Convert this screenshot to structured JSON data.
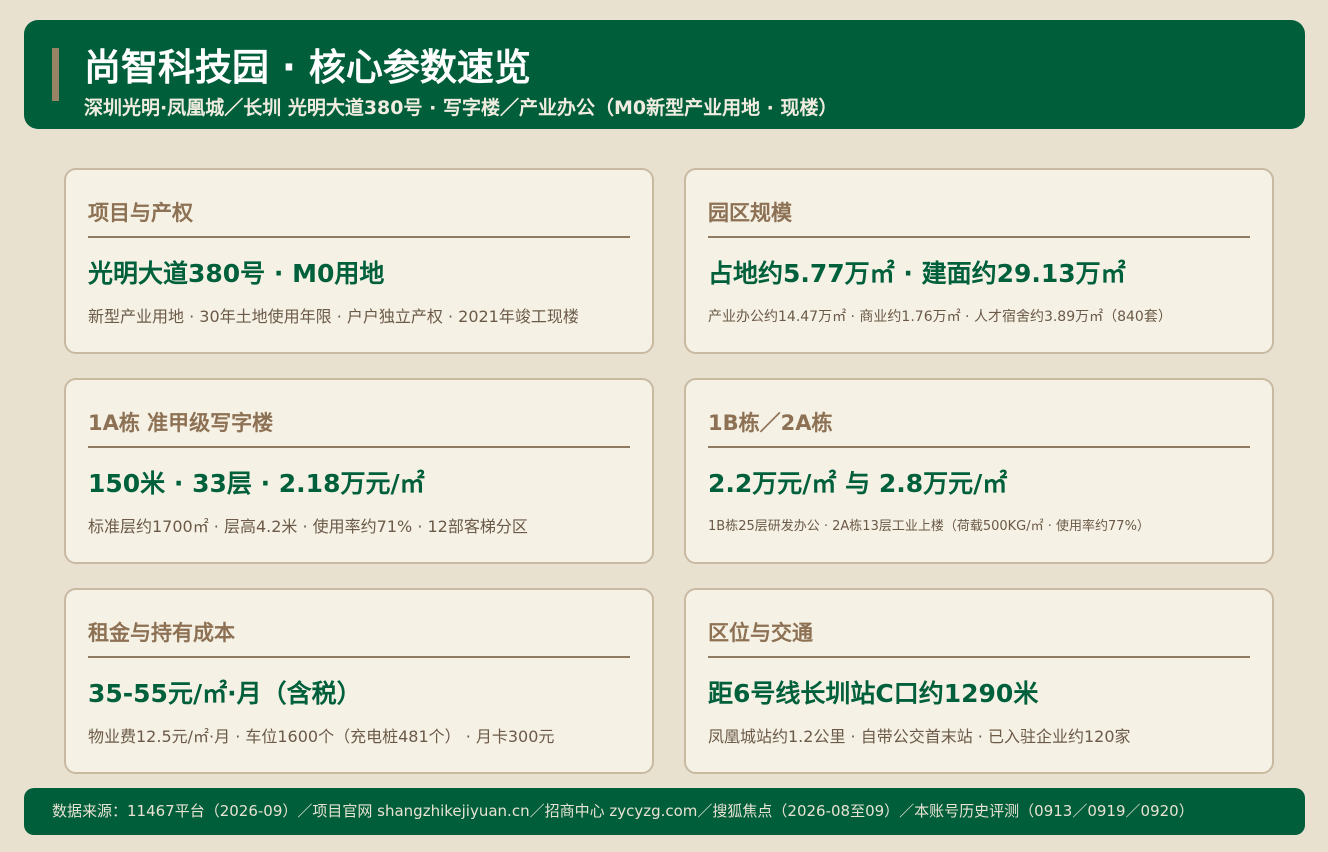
{
  "header": {
    "title": "尚智科技园 · 核心参数速览",
    "subtitle": "深圳光明·凤凰城／长圳 光明大道380号 · 写字楼／产业办公（M0新型产业用地 · 现楼）"
  },
  "cards": [
    {
      "title": "项目与产权",
      "headline": "光明大道380号 · M0用地",
      "detail": "新型产业用地 · 30年土地使用年限 · 户户独立产权 · 2021年竣工现楼"
    },
    {
      "title": "园区规模",
      "headline": "占地约5.77万㎡ · 建面约29.13万㎡",
      "detail": "产业办公约14.47万㎡ · 商业约1.76万㎡ · 人才宿舍约3.89万㎡（840套）"
    },
    {
      "title": "1A栋 准甲级写字楼",
      "headline": "150米 · 33层 · 2.18万元/㎡",
      "detail": "标准层约1700㎡ · 层高4.2米 · 使用率约71% · 12部客梯分区"
    },
    {
      "title": "1B栋／2A栋",
      "headline": "2.2万元/㎡ 与 2.8万元/㎡",
      "detail": "1B栋25层研发办公 · 2A栋13层工业上楼（荷载500KG/㎡ · 使用率约77%）"
    },
    {
      "title": "租金与持有成本",
      "headline": "35-55元/㎡·月（含税）",
      "detail": "物业费12.5元/㎡·月 · 车位1600个（充电桩481个） · 月卡300元"
    },
    {
      "title": "区位与交通",
      "headline": "距6号线长圳站C口约1290米",
      "detail": "凤凰城站约1.2公里 · 自带公交首末站 · 已入驻企业约120家"
    }
  ],
  "footer": {
    "source": "数据来源：11467平台（2026-09）／项目官网 shangzhikejiyuan.cn／招商中心 zycyzg.com／搜狐焦点（2026-08至09）／本账号历史评测（0913／0919／0920）"
  },
  "colors": {
    "background": "#e9e1d0",
    "brand_green": "#005e3a",
    "card_background": "#f6f1e5",
    "card_title": "#8d7154",
    "headline": "#00603b"
  }
}
